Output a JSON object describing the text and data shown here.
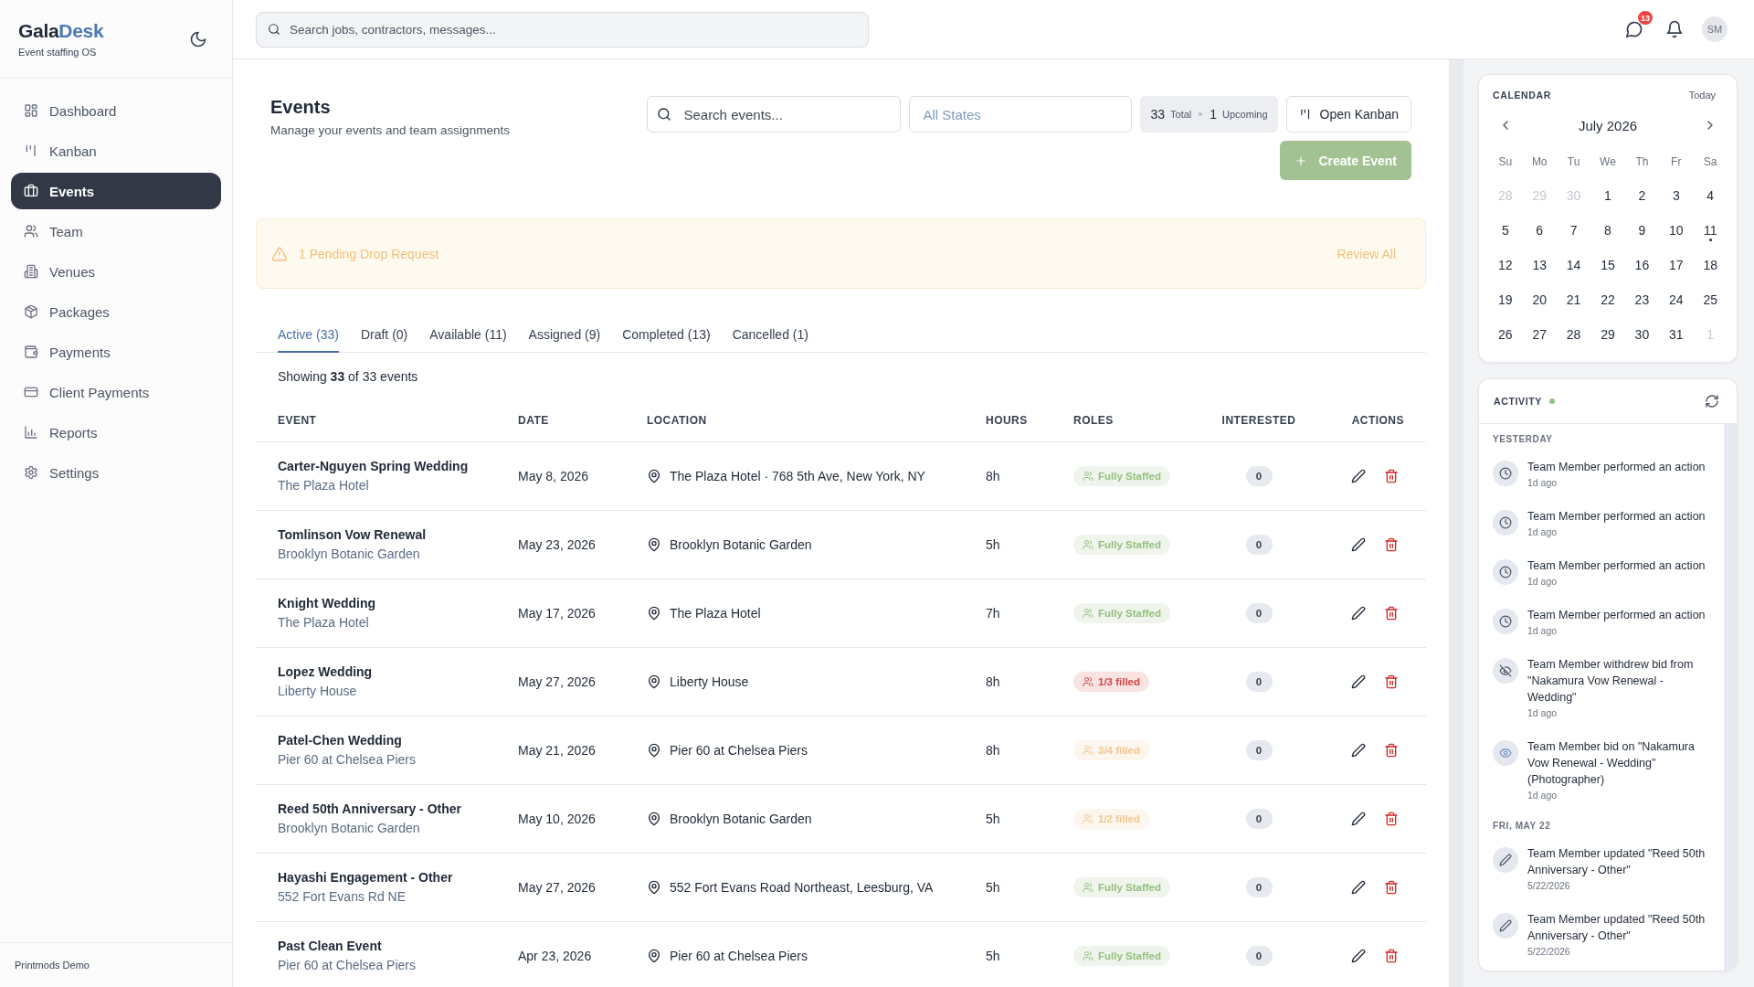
{
  "sidebar": {
    "logo": {
      "text": "Gala",
      "accent": "Desk"
    },
    "tagline": "Event staffing OS",
    "nav": [
      {
        "label": "Dashboard",
        "selected": false
      },
      {
        "label": "Kanban",
        "selected": false
      },
      {
        "label": "Events",
        "selected": true
      },
      {
        "label": "Team",
        "selected": false
      },
      {
        "label": "Venues",
        "selected": false
      },
      {
        "label": "Packages",
        "selected": false
      },
      {
        "label": "Payments",
        "selected": false
      },
      {
        "label": "Client Payments",
        "selected": false
      },
      {
        "label": "Reports",
        "selected": false
      },
      {
        "label": "Settings",
        "selected": false
      }
    ],
    "footer": "Printmods Demo"
  },
  "topbar": {
    "search": {
      "placeholder": "Search jobs, contractors, messages..."
    },
    "messages_badge": "13",
    "avatar": "SM"
  },
  "page": {
    "title": "Events",
    "subtitle": "Manage your events and team assignments",
    "search": {
      "placeholder": "Search events..."
    },
    "state_filter": {
      "placeholder": "All States"
    },
    "stats": {
      "total": "33",
      "total_label": "Total",
      "upcoming": "1",
      "upcoming_label": "Upcoming"
    },
    "kanban_button": "Open Kanban",
    "create_button": "Create Event"
  },
  "alert": {
    "text": "1 Pending Drop Request",
    "action": "Review All"
  },
  "tabs": [
    {
      "label": "Active (33)",
      "selected": true
    },
    {
      "label": "Draft (0)",
      "selected": false
    },
    {
      "label": "Available (11)",
      "selected": false
    },
    {
      "label": "Assigned (9)",
      "selected": false
    },
    {
      "label": "Completed (13)",
      "selected": false
    },
    {
      "label": "Cancelled (1)",
      "selected": false
    }
  ],
  "summary": "Showing **33** of 33 events",
  "table": {
    "columns": [
      "EVENT",
      "DATE",
      "LOCATION",
      "HOURS",
      "ROLES",
      "INTERESTED",
      "ACTIONS"
    ],
    "rows": [
      {
        "event": "Carter-Nguyen Spring Wedding",
        "venue": "The Plaza Hotel",
        "date": "May 8, 2026",
        "location": "The Plaza Hotel · 768 5th Ave, New York, NY",
        "hours": "8h",
        "roles": {
          "text": "Fully Staffed",
          "color": "#92bf7d"
        },
        "interested": "0"
      },
      {
        "event": "Tomlinson Vow Renewal",
        "venue": "Brooklyn Botanic Garden",
        "date": "May 23, 2026",
        "location": "Brooklyn Botanic Garden",
        "hours": "5h",
        "roles": {
          "text": "Fully Staffed",
          "color": "#92bf7d"
        },
        "interested": "0"
      },
      {
        "event": "Knight Wedding",
        "venue": "The Plaza Hotel",
        "date": "May 17, 2026",
        "location": "The Plaza Hotel",
        "hours": "7h",
        "roles": {
          "text": "Fully Staffed",
          "color": "#92bf7d"
        },
        "interested": "0"
      },
      {
        "event": "Lopez Wedding",
        "venue": "Liberty House",
        "date": "May 27, 2026",
        "location": "Liberty House",
        "hours": "8h",
        "roles": {
          "text": "1/3 filled",
          "color": "#d64343"
        },
        "interested": "0"
      },
      {
        "event": "Patel-Chen Wedding",
        "venue": "Pier 60 at Chelsea Piers",
        "date": "May 21, 2026",
        "location": "Pier 60 at Chelsea Piers",
        "hours": "8h",
        "roles": {
          "text": "3/4 filled",
          "color": "#f3c68c"
        },
        "interested": "0"
      },
      {
        "event": "Reed 50th Anniversary - Other",
        "venue": "Brooklyn Botanic Garden",
        "date": "May 10, 2026",
        "location": "Brooklyn Botanic Garden",
        "hours": "5h",
        "roles": {
          "text": "1/2 filled",
          "color": "#f3c68c"
        },
        "interested": "0"
      },
      {
        "event": "Hayashi Engagement - Other",
        "venue": "552 Fort Evans Rd NE",
        "date": "May 27, 2026",
        "location": "552 Fort Evans Road Northeast, Leesburg, VA",
        "hours": "5h",
        "roles": {
          "text": "Fully Staffed",
          "color": "#92bf7d"
        },
        "interested": "0"
      },
      {
        "event": "Past Clean Event",
        "venue": "Pier 60 at Chelsea Piers",
        "date": "Apr 23, 2026",
        "location": "Pier 60 at Chelsea Piers",
        "hours": "5h",
        "roles": {
          "text": "Fully Staffed",
          "color": "#92bf7d"
        },
        "interested": "0"
      }
    ]
  },
  "calendar": {
    "title": "CALENDAR",
    "today_button": "Today",
    "month": "July 2026",
    "weekdays": [
      "Su",
      "Mo",
      "Tu",
      "We",
      "Th",
      "Fr",
      "Sa"
    ],
    "weeks": [
      [
        {
          "day": "28",
          "outside": true,
          "marked": false
        },
        {
          "day": "29",
          "outside": true,
          "marked": false
        },
        {
          "day": "30",
          "outside": true,
          "marked": false
        },
        {
          "day": "1",
          "outside": false,
          "marked": false
        },
        {
          "day": "2",
          "outside": false,
          "marked": false
        },
        {
          "day": "3",
          "outside": false,
          "marked": false
        },
        {
          "day": "4",
          "outside": false,
          "marked": false
        }
      ],
      [
        {
          "day": "5",
          "outside": false,
          "marked": false
        },
        {
          "day": "6",
          "outside": false,
          "marked": false
        },
        {
          "day": "7",
          "outside": false,
          "marked": false
        },
        {
          "day": "8",
          "outside": false,
          "marked": false
        },
        {
          "day": "9",
          "outside": false,
          "marked": false
        },
        {
          "day": "10",
          "outside": false,
          "marked": false
        },
        {
          "day": "11",
          "outside": false,
          "marked": true
        }
      ],
      [
        {
          "day": "12",
          "outside": false,
          "marked": false
        },
        {
          "day": "13",
          "outside": false,
          "marked": false
        },
        {
          "day": "14",
          "outside": false,
          "marked": false
        },
        {
          "day": "15",
          "outside": false,
          "marked": false
        },
        {
          "day": "16",
          "outside": false,
          "marked": false
        },
        {
          "day": "17",
          "outside": false,
          "marked": false
        },
        {
          "day": "18",
          "outside": false,
          "marked": false
        }
      ],
      [
        {
          "day": "19",
          "outside": false,
          "marked": false
        },
        {
          "day": "20",
          "outside": false,
          "marked": false
        },
        {
          "day": "21",
          "outside": false,
          "marked": false
        },
        {
          "day": "22",
          "outside": false,
          "marked": false
        },
        {
          "day": "23",
          "outside": false,
          "marked": false
        },
        {
          "day": "24",
          "outside": false,
          "marked": false
        },
        {
          "day": "25",
          "outside": false,
          "marked": false
        }
      ],
      [
        {
          "day": "26",
          "outside": false,
          "marked": false
        },
        {
          "day": "27",
          "outside": false,
          "marked": false
        },
        {
          "day": "28",
          "outside": false,
          "marked": false
        },
        {
          "day": "29",
          "outside": false,
          "marked": false
        },
        {
          "day": "30",
          "outside": false,
          "marked": false
        },
        {
          "day": "31",
          "outside": false,
          "marked": false
        },
        {
          "day": "1",
          "outside": true,
          "marked": false
        }
      ]
    ]
  },
  "activity": {
    "title": "ACTIVITY",
    "live": true,
    "groups": [
      {
        "label": "YESTERDAY",
        "items": [
          {
            "kind": "action",
            "text": "Team Member performed an action",
            "time": "1d ago"
          },
          {
            "kind": "action",
            "text": "Team Member performed an action",
            "time": "1d ago"
          },
          {
            "kind": "action",
            "text": "Team Member performed an action",
            "time": "1d ago"
          },
          {
            "kind": "action",
            "text": "Team Member performed an action",
            "time": "1d ago"
          },
          {
            "kind": "withdraw",
            "text": "Team Member withdrew bid from \"Nakamura Vow Renewal - Wedding\"",
            "time": "1d ago"
          },
          {
            "kind": "bid",
            "text": "Team Member bid on \"Nakamura Vow Renewal - Wedding\" (Photographer)",
            "time": "1d ago"
          }
        ]
      },
      {
        "label": "FRI, MAY 22",
        "items": [
          {
            "kind": "update",
            "text": "Team Member updated \"Reed 50th Anniversary - Other\"",
            "time": "5/22/2026"
          },
          {
            "kind": "update",
            "text": "Team Member updated \"Reed 50th Anniversary - Other\"",
            "time": "5/22/2026"
          }
        ]
      }
    ]
  }
}
